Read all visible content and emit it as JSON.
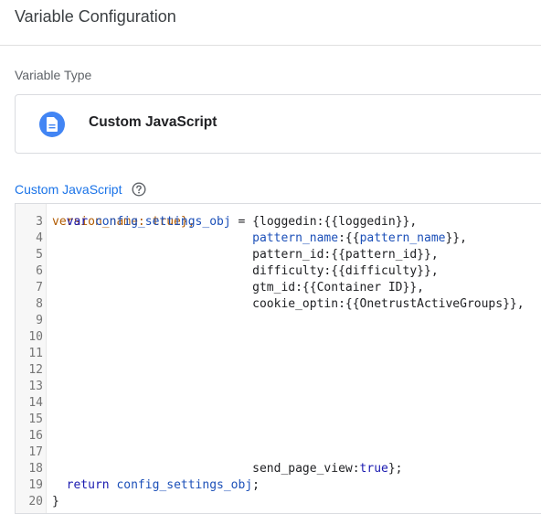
{
  "header": {
    "title": "Variable Configuration"
  },
  "variable_type": {
    "label": "Variable Type",
    "selected": "Custom JavaScript",
    "icon": "document-icon",
    "icon_color": "#4285f4"
  },
  "code_section": {
    "label": "Custom JavaScript",
    "help_icon": "help-circle-icon",
    "label_color": "#1a73e8"
  },
  "editor": {
    "partial_top_line": "version_name: true},",
    "lines": [
      {
        "n": "3",
        "text": "  var config_settings_obj = {loggedin:{{loggedin}},"
      },
      {
        "n": "4",
        "text": "                            pattern_name:{{pattern_name}},"
      },
      {
        "n": "5",
        "text": "                            pattern_id:{{pattern_id}},"
      },
      {
        "n": "6",
        "text": "                            difficulty:{{difficulty}},"
      },
      {
        "n": "7",
        "text": "                            gtm_id:{{Container ID}},"
      },
      {
        "n": "8",
        "text": "                            cookie_optin:{{OnetrustActiveGroups}},"
      },
      {
        "n": "9",
        "text": ""
      },
      {
        "n": "10",
        "text": ""
      },
      {
        "n": "11",
        "text": ""
      },
      {
        "n": "12",
        "text": ""
      },
      {
        "n": "13",
        "text": ""
      },
      {
        "n": "14",
        "text": ""
      },
      {
        "n": "15",
        "text": ""
      },
      {
        "n": "16",
        "text": ""
      },
      {
        "n": "17",
        "text": ""
      },
      {
        "n": "18",
        "text": "                            send_page_view:true};"
      },
      {
        "n": "19",
        "text": "  return config_settings_obj;"
      },
      {
        "n": "20",
        "text": "}"
      }
    ]
  }
}
